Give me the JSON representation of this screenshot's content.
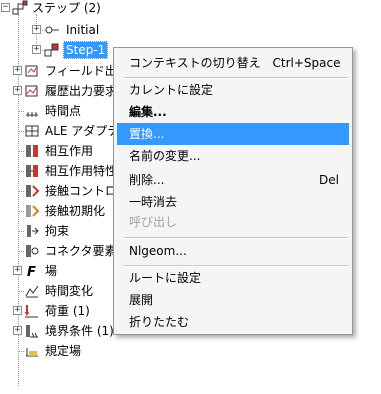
{
  "tree": {
    "steps_label": "ステップ (2)",
    "initial_label": "Initial",
    "step1_label": "Step-1",
    "items": [
      {
        "label": "フィールド出力要求",
        "expander": "+",
        "icon": "field-output-icon"
      },
      {
        "label": "履歴出力要求",
        "expander": "+",
        "icon": "history-output-icon"
      },
      {
        "label": "時間点",
        "expander": "",
        "icon": "time-points-icon"
      },
      {
        "label": "ALE アダプティブ",
        "expander": "",
        "icon": "ale-icon"
      },
      {
        "label": "相互作用",
        "expander": "",
        "icon": "interaction-icon"
      },
      {
        "label": "相互作用特性",
        "expander": "",
        "icon": "interaction-property-icon"
      },
      {
        "label": "接触コントロール",
        "expander": "",
        "icon": "contact-control-icon"
      },
      {
        "label": "接触初期化",
        "expander": "",
        "icon": "contact-init-icon"
      },
      {
        "label": "拘束",
        "expander": "",
        "icon": "constraint-icon"
      },
      {
        "label": "コネクタ要素",
        "expander": "",
        "icon": "connector-icon"
      },
      {
        "label": "場",
        "expander": "+",
        "icon": "field-icon"
      },
      {
        "label": "時間変化",
        "expander": "",
        "icon": "amplitude-icon"
      },
      {
        "label": "荷重 (1)",
        "expander": "+",
        "icon": "load-icon"
      },
      {
        "label": "境界条件 (1)",
        "expander": "+",
        "icon": "bc-icon"
      },
      {
        "label": "規定場",
        "expander": "",
        "icon": "predefined-field-icon"
      }
    ]
  },
  "context_menu": {
    "items": [
      {
        "label": "コンテキストの切り替え",
        "shortcut": "Ctrl+Space"
      },
      {
        "label": "カレントに設定",
        "shortcut": ""
      },
      {
        "label": "編集...",
        "shortcut": ""
      },
      {
        "label": "置換...",
        "shortcut": ""
      },
      {
        "label": "名前の変更...",
        "shortcut": ""
      },
      {
        "label": "削除...",
        "shortcut": "Del"
      },
      {
        "label": "一時消去",
        "shortcut": ""
      },
      {
        "label": "呼び出し",
        "shortcut": ""
      },
      {
        "label": "Nlgeom...",
        "shortcut": ""
      },
      {
        "label": "ルートに設定",
        "shortcut": ""
      },
      {
        "label": "展開",
        "shortcut": ""
      },
      {
        "label": "折りたたむ",
        "shortcut": ""
      }
    ]
  },
  "colors": {
    "selection": "#3399ff",
    "menu_background": "#f5f5f5",
    "disabled_text": "#a0a0a0"
  }
}
